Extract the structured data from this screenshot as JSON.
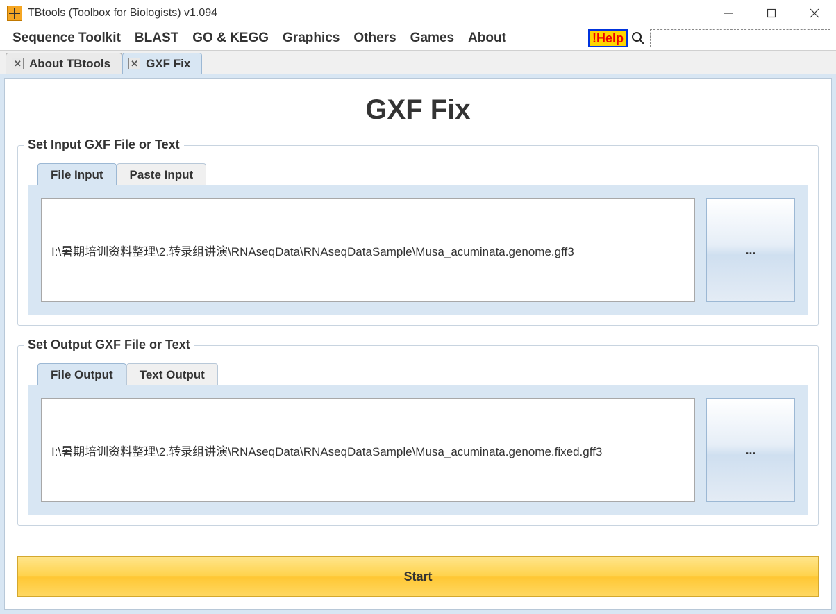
{
  "window": {
    "title": "TBtools (Toolbox for Biologists) v1.094"
  },
  "menubar": {
    "items": [
      "Sequence Toolkit",
      "BLAST",
      "GO & KEGG",
      "Graphics",
      "Others",
      "Games",
      "About"
    ],
    "help_label": "!Help"
  },
  "tabs": [
    {
      "label": "About TBtools",
      "active": false
    },
    {
      "label": "GXF Fix",
      "active": true
    }
  ],
  "page": {
    "title": "GXF Fix",
    "input_section": {
      "legend": "Set Input GXF File or Text",
      "tabs": [
        "File Input",
        "Paste Input"
      ],
      "active_tab": 0,
      "file_path": "I:\\暑期培训资料整理\\2.转录组讲演\\RNAseqData\\RNAseqDataSample\\Musa_acuminata.genome.gff3",
      "browse_label": "..."
    },
    "output_section": {
      "legend": "Set Output GXF File or Text",
      "tabs": [
        "File Output",
        "Text Output"
      ],
      "active_tab": 0,
      "file_path": "I:\\暑期培训资料整理\\2.转录组讲演\\RNAseqData\\RNAseqDataSample\\Musa_acuminata.genome.fixed.gff3",
      "browse_label": "..."
    },
    "start_label": "Start"
  }
}
